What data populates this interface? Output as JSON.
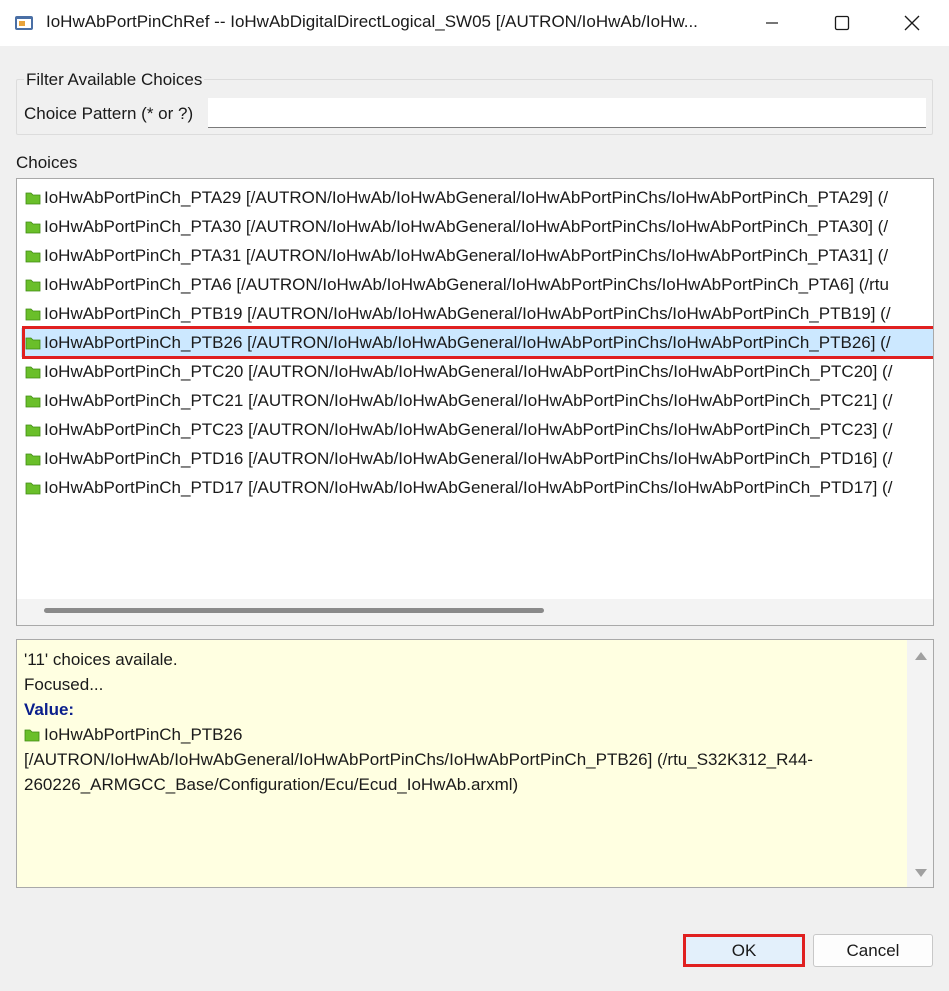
{
  "window": {
    "title": "IoHwAbPortPinChRef -- IoHwAbDigitalDirectLogical_SW05 [/AUTRON/IoHwAb/IoHw..."
  },
  "filter": {
    "legend": "Filter Available Choices",
    "pattern_label": "Choice Pattern (* or ?)",
    "pattern_value": ""
  },
  "choices": {
    "label": "Choices",
    "items": [
      "IoHwAbPortPinCh_PTA29 [/AUTRON/IoHwAb/IoHwAbGeneral/IoHwAbPortPinChs/IoHwAbPortPinCh_PTA29] (/",
      "IoHwAbPortPinCh_PTA30 [/AUTRON/IoHwAb/IoHwAbGeneral/IoHwAbPortPinChs/IoHwAbPortPinCh_PTA30] (/",
      "IoHwAbPortPinCh_PTA31 [/AUTRON/IoHwAb/IoHwAbGeneral/IoHwAbPortPinChs/IoHwAbPortPinCh_PTA31] (/",
      "IoHwAbPortPinCh_PTA6 [/AUTRON/IoHwAb/IoHwAbGeneral/IoHwAbPortPinChs/IoHwAbPortPinCh_PTA6] (/rtu",
      "IoHwAbPortPinCh_PTB19 [/AUTRON/IoHwAb/IoHwAbGeneral/IoHwAbPortPinChs/IoHwAbPortPinCh_PTB19] (/",
      "IoHwAbPortPinCh_PTB26 [/AUTRON/IoHwAb/IoHwAbGeneral/IoHwAbPortPinChs/IoHwAbPortPinCh_PTB26] (/",
      "IoHwAbPortPinCh_PTC20 [/AUTRON/IoHwAb/IoHwAbGeneral/IoHwAbPortPinChs/IoHwAbPortPinCh_PTC20] (/",
      "IoHwAbPortPinCh_PTC21 [/AUTRON/IoHwAb/IoHwAbGeneral/IoHwAbPortPinChs/IoHwAbPortPinCh_PTC21] (/",
      "IoHwAbPortPinCh_PTC23 [/AUTRON/IoHwAb/IoHwAbGeneral/IoHwAbPortPinChs/IoHwAbPortPinCh_PTC23] (/",
      "IoHwAbPortPinCh_PTD16 [/AUTRON/IoHwAb/IoHwAbGeneral/IoHwAbPortPinChs/IoHwAbPortPinCh_PTD16] (/",
      "IoHwAbPortPinCh_PTD17 [/AUTRON/IoHwAb/IoHwAbGeneral/IoHwAbPortPinChs/IoHwAbPortPinCh_PTD17] (/"
    ],
    "selected_index": 5,
    "item_icon": "folder-icon",
    "folder_color": "#6abf2a"
  },
  "info": {
    "count_line": "'11' choices availale.",
    "focused_line": "Focused...",
    "value_label": "Value:",
    "value_name": "IoHwAbPortPinCh_PTB26",
    "value_path_1": "[/AUTRON/IoHwAb/IoHwAbGeneral/IoHwAbPortPinChs/IoHwAbPortPinCh_PTB26] (/rtu_S32K312_R44-",
    "value_path_2": "260226_ARMGCC_Base/Configuration/Ecu/Ecud_IoHwAb.arxml)"
  },
  "buttons": {
    "ok": "OK",
    "cancel": "Cancel"
  },
  "colors": {
    "highlight": "#e02020",
    "selection": "#cce8ff",
    "info_background": "#ffffe1"
  }
}
